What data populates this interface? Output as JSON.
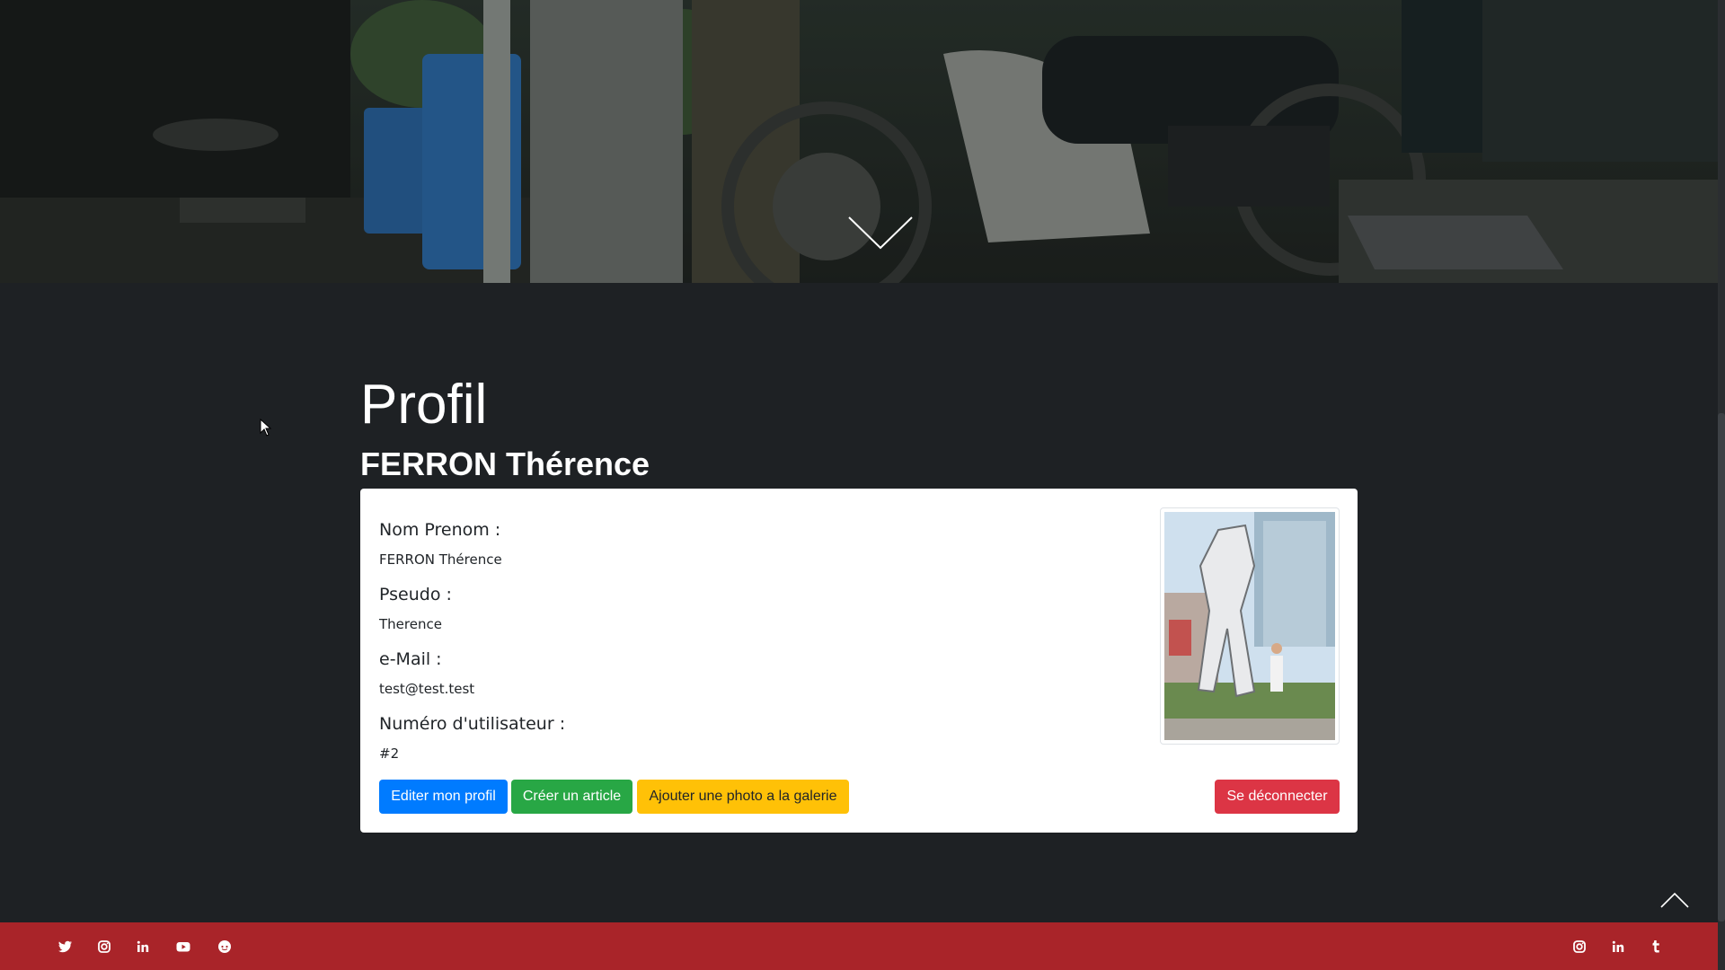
{
  "page": {
    "title": "Profil",
    "user_name": "FERRON Thérence"
  },
  "profile": {
    "fields": [
      {
        "label": "Nom Prenom :",
        "value": "FERRON Thérence"
      },
      {
        "label": "Pseudo :",
        "value": "Therence"
      },
      {
        "label": "e-Mail :",
        "value": "test@test.test"
      },
      {
        "label": "Numéro d'utilisateur :",
        "value": "#2"
      }
    ]
  },
  "actions": {
    "edit_profile": "Editer mon profil",
    "create_article": "Créer un article",
    "add_photo": "Ajouter une photo a la galerie",
    "logout": "Se déconnecter"
  },
  "colors": {
    "background": "#1e2124",
    "footer": "#a92429",
    "primary": "#007bff",
    "success": "#28a745",
    "warning": "#ffc107",
    "danger": "#dc3545"
  },
  "footer": {
    "left_social": [
      "twitter-icon",
      "instagram-icon",
      "linkedin-icon",
      "youtube-icon",
      "reddit-icon"
    ],
    "right_social": [
      "instagram-icon",
      "linkedin-icon",
      "tumblr-icon"
    ]
  }
}
